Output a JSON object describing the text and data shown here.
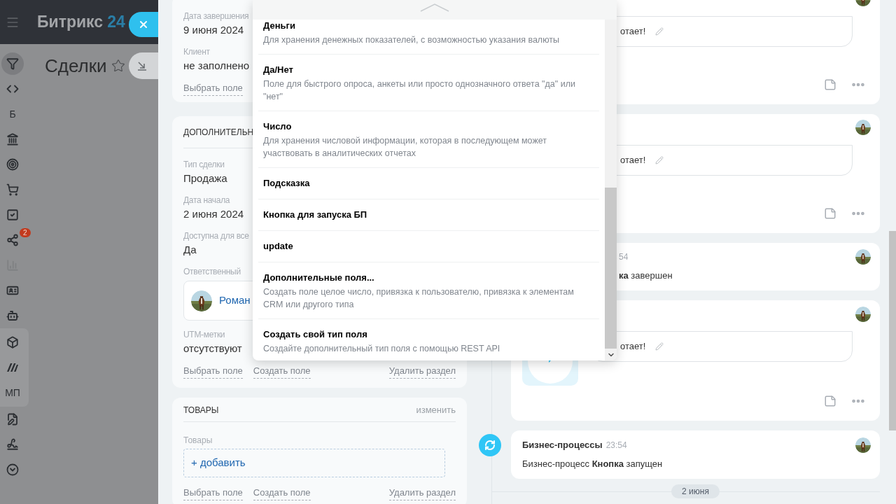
{
  "app_header": {
    "logo_text": "Битрикс",
    "logo_number": "24"
  },
  "sidebar": {
    "items": [
      {
        "kind": "icon",
        "selected": true,
        "disabled": false
      },
      {
        "kind": "icon",
        "selected": false,
        "disabled": false
      },
      {
        "kind": "text",
        "label": "Б",
        "selected": false,
        "disabled": false
      },
      {
        "kind": "icon",
        "selected": false,
        "disabled": false
      },
      {
        "kind": "icon",
        "selected": false,
        "disabled": false
      },
      {
        "kind": "icon",
        "selected": false,
        "disabled": false
      },
      {
        "kind": "icon",
        "selected": false,
        "disabled": false
      },
      {
        "kind": "icon",
        "badge": "2",
        "selected": false,
        "disabled": false
      },
      {
        "kind": "icon",
        "selected": false,
        "disabled": true
      },
      {
        "kind": "icon",
        "selected": false,
        "disabled": false
      },
      {
        "kind": "icon",
        "selected": false,
        "disabled": false
      }
    ],
    "group": [
      {
        "kind": "icon",
        "selected": false,
        "disabled": false
      },
      {
        "kind": "icon",
        "selected": false,
        "disabled": false
      },
      {
        "kind": "text",
        "label": "МП",
        "selected": false,
        "disabled": false
      }
    ],
    "items_after": [
      {
        "kind": "icon",
        "selected": false,
        "disabled": false
      },
      {
        "kind": "icon",
        "selected": false,
        "disabled": false
      },
      {
        "kind": "icon",
        "selected": false,
        "disabled": false
      }
    ]
  },
  "page": {
    "title": "Сделки"
  },
  "main_card": {
    "fields": [
      {
        "label": "Дата завершения",
        "value": "9 июня 2024"
      },
      {
        "label": "Клиент",
        "value": "не заполнено"
      }
    ],
    "links": [
      "Выбрать поле"
    ]
  },
  "extra_section": {
    "title": "ДОПОЛНИТЕЛЬН",
    "fields": [
      {
        "kind": "text",
        "label": "Тип сделки",
        "value": "Продажа"
      },
      {
        "kind": "text",
        "label": "Дата начала",
        "value": "2 июня 2024"
      },
      {
        "kind": "text",
        "label": "Доступна для все",
        "value": "Да"
      },
      {
        "kind": "user",
        "label": "Ответственный",
        "value": "Роман"
      },
      {
        "kind": "text",
        "label": "UTM-метки",
        "value": "отсутствуют"
      }
    ],
    "links": [
      "Выбрать поле",
      "Создать поле"
    ],
    "delete_link": "Удалить раздел"
  },
  "products_section": {
    "title": "ТОВАРЫ",
    "edit_link": "изменить",
    "field_label": "Товары",
    "add_button": "+ добавить",
    "links": [
      "Выбрать поле",
      "Создать поле"
    ],
    "delete_link": "Удалить раздел"
  },
  "timeline": {
    "items": [
      {
        "kind": "comment",
        "text": "отает!"
      },
      {
        "kind": "comment",
        "text": "отает!"
      },
      {
        "kind": "status",
        "time": "54",
        "text": "**ка** завершен"
      },
      {
        "kind": "chat",
        "text": "отает!"
      },
      {
        "kind": "process",
        "author": "Бизнес-процессы",
        "time": "23:54",
        "text": "Бизнес-процесс **Кнопка** запущен"
      }
    ],
    "date_divider": "2 июня"
  },
  "field_type_menu": {
    "items": [
      {
        "title": "Деньги",
        "description": "Для хранения денежных показателей, с возможностью указания валюты"
      },
      {
        "title": "Да/Нет",
        "description": "Поле для быстрого опроса, анкеты или просто однозначного ответа \"да\" или \"нет\""
      },
      {
        "title": "Число",
        "description": "Для хранения числовой информации, которая в последующем может участвовать в аналитических отчетах"
      },
      {
        "title": "Подсказка"
      },
      {
        "title": "Кнопка для запуска БП"
      },
      {
        "title": "update"
      },
      {
        "title": "Дополнительные поля...",
        "description": "Создать поле целое число, привязка к пользователю, привязка к элементам CRM или другого типа"
      },
      {
        "title": "Создать свой тип поля",
        "description": "Создайте дополнительный тип поля с помощью REST API"
      }
    ]
  }
}
